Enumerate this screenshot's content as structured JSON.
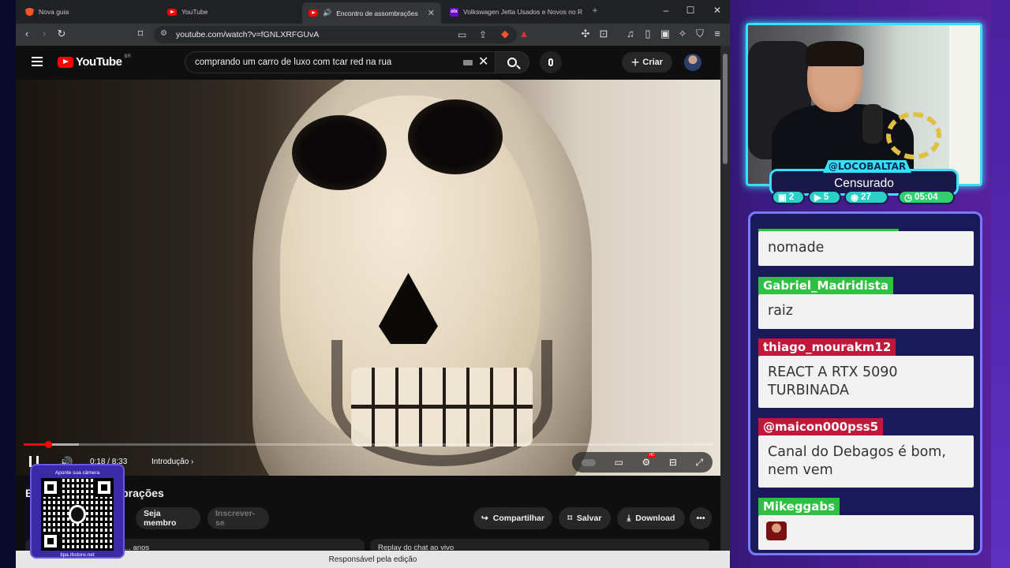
{
  "browser": {
    "tabs": [
      {
        "label": "Nova guia",
        "favicon": "brave-icon"
      },
      {
        "label": "YouTube",
        "favicon": "youtube-icon"
      },
      {
        "label": "Encontro de assombrações - YouTube",
        "favicon": "youtube-icon"
      },
      {
        "label": "Volkswagen Jetta Usados e Novos no RJ",
        "favicon": "olx-icon"
      }
    ],
    "new_tab": "+",
    "url": "youtube.com/watch?v=fGNLXRFGUvA",
    "brave_shield_count": "",
    "status_text": "Responsável pela edição"
  },
  "youtube": {
    "logo_text": "YouTube",
    "logo_country": "BR",
    "search_value": "comprando um carro de luxo com tcar red na rua",
    "create_label": "Criar",
    "player": {
      "time": "0:18 / 8:33",
      "chapter": "Introdução",
      "progress_played": 0.036,
      "progress_buffered": 0.08
    },
    "video_title_fragment_left": "E",
    "video_title_fragment_right": "brações",
    "join_label": "Seja membro",
    "subscribe_label": "Inscrever-se",
    "share_label": "Compartilhar",
    "save_label": "Salvar",
    "download_label": "Download",
    "card_left": "... anos",
    "card_right": "Replay do chat ao vivo"
  },
  "qr": {
    "top_text": "Aponte sua câmera",
    "bottom_text": "tipa.rbstore.net"
  },
  "stream": {
    "handle": "@LOCOBALTAR",
    "status": "Censurado",
    "stats": [
      {
        "icon": "twitch-icon",
        "value": "2"
      },
      {
        "icon": "youtube-icon",
        "value": "5"
      },
      {
        "icon": "kick-icon",
        "value": "27"
      },
      {
        "icon": "clock-icon",
        "value": "05:04"
      }
    ]
  },
  "chat": [
    {
      "user": "",
      "text": "nomade",
      "color": "green"
    },
    {
      "user": "Gabriel_Madridista",
      "text": "raiz",
      "color": "green"
    },
    {
      "user": "thiago_mourakm12",
      "text": "REACT A RTX 5090 TURBINADA",
      "color": "red"
    },
    {
      "user": "@maicon000pss5",
      "text": "Canal do Debagos é bom, nem vem",
      "color": "red"
    },
    {
      "user": "Mikeggabs",
      "text": "",
      "color": "green"
    }
  ],
  "colors": {
    "accent": "#38e0ff",
    "youtube_red": "#ff0000",
    "chat_green": "#2ec040",
    "chat_red": "#c0183a"
  }
}
